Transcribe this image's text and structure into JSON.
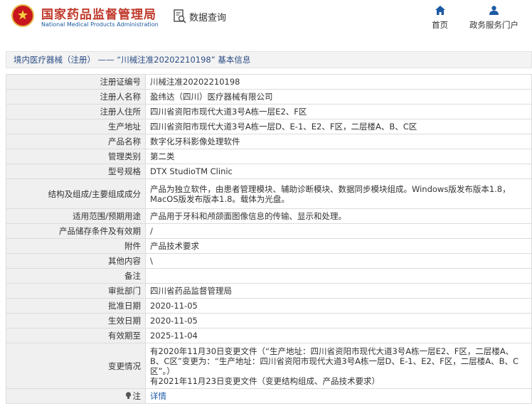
{
  "header": {
    "brand_cn": "国家药品监督管理局",
    "brand_en": "National Medical Products Administration",
    "query_label": "数据查询",
    "nav": [
      {
        "label": "首页",
        "icon": "home-icon"
      },
      {
        "label": "政务服务门户",
        "icon": "user-icon"
      }
    ]
  },
  "breadcrumb": "境内医疗器械（注册） —— “川械注准20202210198” 基本信息",
  "rows": [
    {
      "label": "注册证编号",
      "value": "川械注准20202210198"
    },
    {
      "label": "注册人名称",
      "value": "盈纬达（四川）医疗器械有限公司"
    },
    {
      "label": "注册人住所",
      "value": "四川省资阳市现代大道3号A栋一层E2、F区"
    },
    {
      "label": "生产地址",
      "value": "四川省资阳市现代大道3号A栋一层D、E-1、E2、F区，二层楼A、B、C区"
    },
    {
      "label": "产品名称",
      "value": "数字化牙科影像处理软件"
    },
    {
      "label": "管理类别",
      "value": "第二类"
    },
    {
      "label": "型号规格",
      "value": "DTX StudioTM Clinic"
    },
    {
      "label": "结构及组成/主要组成成分",
      "value": "产品为独立软件，由患者管理模块、辅助诊断模块、数据同步模块组成。Windows版发布版本1.8，MacOS版发布版本1.8。载体为光盘。"
    },
    {
      "label": "适用范围/预期用途",
      "value": "产品用于牙科和颅颌面图像信息的传输、显示和处理。"
    },
    {
      "label": "产品储存条件及有效期",
      "value": "/"
    },
    {
      "label": "附件",
      "value": "产品技术要求"
    },
    {
      "label": "其他内容",
      "value": "\\"
    },
    {
      "label": "备注",
      "value": ""
    },
    {
      "label": "审批部门",
      "value": "四川省药品监督管理局"
    },
    {
      "label": "批准日期",
      "value": "2020-11-05"
    },
    {
      "label": "生效日期",
      "value": "2020-11-05"
    },
    {
      "label": "有效期至",
      "value": "2025-11-04"
    }
  ],
  "change": {
    "label": "变更情况",
    "line1": "有2020年11月30日变更文件（“生产地址：四川省资阳市现代大道3号A栋一层E2、F区，二层楼A、B、C区”变更为：“生产地址：四川省资阳市现代大道3号A栋一层D、E-1、E2、F区，二层楼A、B、C区”。）",
    "line2": "有2021年11月23日变更文件（变更结构组成、产品技术要求）"
  },
  "note": {
    "label": "注",
    "icon": "lightbulb-icon",
    "link": "详情"
  }
}
